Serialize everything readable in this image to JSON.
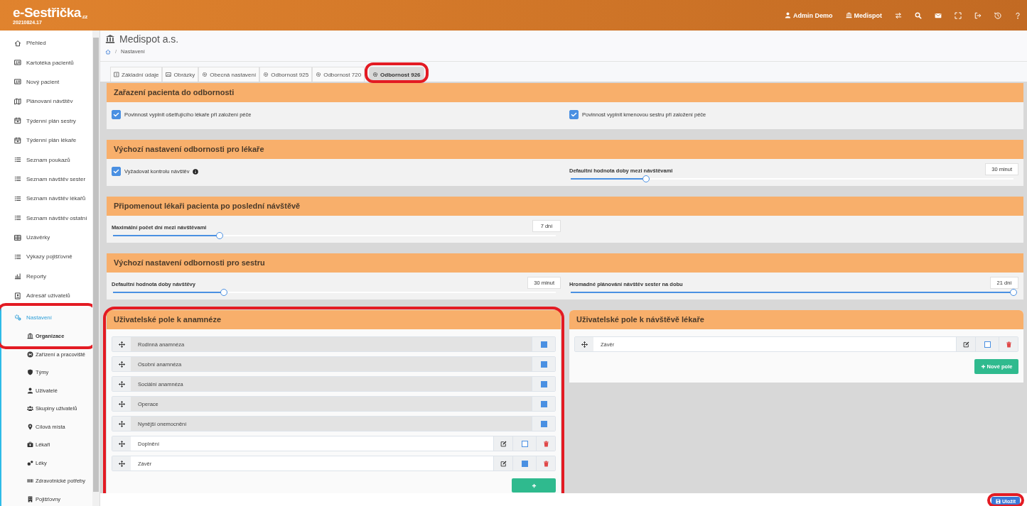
{
  "header": {
    "logo": "e-Sestřička",
    "logo_suffix": ".cz",
    "version": "20210824.17",
    "user": "Admin Demo",
    "organization": "Medispot"
  },
  "sidebar": {
    "items": [
      {
        "label": "Přehled",
        "selected": false
      },
      {
        "label": "Kartotéka pacientů",
        "selected": false
      },
      {
        "label": "Nový pacient",
        "selected": false
      },
      {
        "label": "Plánovaní návštěv",
        "selected": false
      },
      {
        "label": "Týdenní plán sestry",
        "selected": false
      },
      {
        "label": "Týdenní plán lékaře",
        "selected": false
      },
      {
        "label": "Seznam poukazů",
        "selected": false
      },
      {
        "label": "Seznam návštěv sester",
        "selected": false
      },
      {
        "label": "Seznam návštěv lékařů",
        "selected": false
      },
      {
        "label": "Seznam návštěv ostatní",
        "selected": false
      },
      {
        "label": "Uzávěrky",
        "selected": false
      },
      {
        "label": "Výkazy pojišťovně",
        "selected": false
      },
      {
        "label": "Reporty",
        "selected": false
      },
      {
        "label": "Adresář uživatelů",
        "selected": false
      },
      {
        "label": "Nastavení",
        "selected": true,
        "expanded": true,
        "children": [
          {
            "label": "Organizace",
            "selected": true
          },
          {
            "label": "Zařízení a pracoviště",
            "selected": false
          },
          {
            "label": "Týmy",
            "selected": false
          },
          {
            "label": "Uživatelé",
            "selected": false
          },
          {
            "label": "Skupiny uživatelů",
            "selected": false
          },
          {
            "label": "Cílová místa",
            "selected": false
          },
          {
            "label": "Lékaři",
            "selected": false
          },
          {
            "label": "Léky",
            "selected": false
          },
          {
            "label": "Zdravotnické potřeby",
            "selected": false
          },
          {
            "label": "Pojišťovny",
            "selected": false
          }
        ]
      }
    ]
  },
  "page": {
    "title": "Medispot a.s.",
    "breadcrumb_separator": "/",
    "breadcrumb": "Nastavení"
  },
  "tabs": [
    {
      "label": "Základní údaje",
      "selected": false
    },
    {
      "label": "Obrázky",
      "selected": false
    },
    {
      "label": "Obecná nastavení",
      "selected": false
    },
    {
      "label": "Odbornost 925",
      "selected": false
    },
    {
      "label": "Odbornost 720",
      "selected": false
    },
    {
      "label": "Odbornost 926",
      "selected": true
    }
  ],
  "sections": [
    {
      "title": "Zařazení pacienta do odbornosti",
      "left": [
        {
          "kind": "checkbox",
          "label": "Povinnost vyplnit ošetřujícího lékaře při založení péče",
          "checked": true
        }
      ],
      "right": [
        {
          "kind": "checkbox",
          "label": "Povinnost vyplnit kmenovou sestru při založení péče",
          "checked": true
        }
      ]
    },
    {
      "title": "Výchozí nastavení odbornosti pro lékaře",
      "left": [
        {
          "kind": "checkbox",
          "label": "Vyžadovat kontrolu návštěv",
          "checked": true,
          "info": true
        }
      ],
      "right": [
        {
          "kind": "slider",
          "label": "Defaultní hodnota doby mezi návštěvami",
          "value": "30 minut",
          "level": 0.17
        }
      ]
    },
    {
      "title": "Připomenout lékaři pacienta po poslední návštěvě",
      "left": [
        {
          "kind": "slider",
          "label": "Maximální počet dní mezi návštěvami",
          "value": "7 dní",
          "level": 0.24
        }
      ]
    },
    {
      "title": "Výchozí nastavení odbornosti pro sestru",
      "left": [
        {
          "kind": "slider",
          "label": "Defaultní hodnota doby návštěvy",
          "value": "30 minut",
          "level": 0.25
        }
      ],
      "right": [
        {
          "kind": "slider",
          "label": "Hromadné plánování návštěv sester na dobu",
          "value": "21 dní",
          "level": 1
        }
      ]
    }
  ],
  "panels": [
    {
      "title": "Uživatelské pole k anamnéze",
      "fields": [
        {
          "label": "Rodinná anamnéza",
          "kind": "fixed",
          "checked": true
        },
        {
          "label": "Osobní anamnéza",
          "kind": "fixed",
          "checked": true
        },
        {
          "label": "Sociální anamnéza",
          "kind": "fixed",
          "checked": true
        },
        {
          "label": "Operace",
          "kind": "fixed",
          "checked": true
        },
        {
          "label": "Nynější onemocnění",
          "kind": "fixed",
          "checked": true
        },
        {
          "label": "Doplnění",
          "kind": "custom",
          "checked": false
        },
        {
          "label": "Závěr",
          "kind": "custom",
          "checked": true
        }
      ]
    },
    {
      "title": "Uživatelské pole k návštěvě lékaře",
      "fields": [
        {
          "label": "Závěr",
          "kind": "custom",
          "checked": false
        }
      ],
      "add_button": "Nové pole"
    }
  ],
  "save_button": "Uložit"
}
